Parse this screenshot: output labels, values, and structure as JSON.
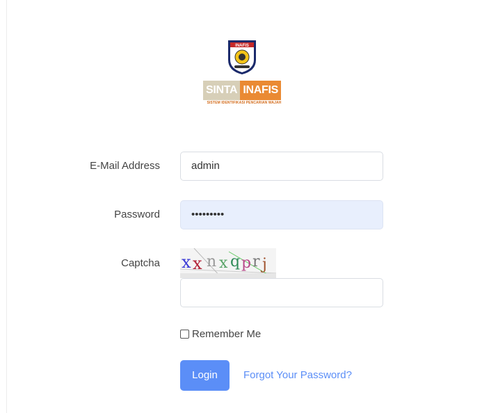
{
  "logo": {
    "emblem_text": "INAFIS",
    "brand_left": "SINTA",
    "brand_right": "INAFIS",
    "subtitle": "SISTEM IDENTIFIKASI PENCARIAN WAJAH",
    "colors": {
      "beige": "#d7cfb8",
      "orange": "#ea8a33",
      "red": "#c62828"
    }
  },
  "form": {
    "email": {
      "label": "E-Mail Address",
      "value": "admin"
    },
    "password": {
      "label": "Password",
      "masked_value": "•••••••••"
    },
    "captcha": {
      "label": "Captcha",
      "image_text": "xxnxqprj",
      "input_value": ""
    },
    "remember": {
      "label": "Remember Me",
      "checked": false
    },
    "login_label": "Login",
    "forgot_label": "Forgot Your Password?"
  },
  "colors": {
    "accent": "#5b8ef7",
    "autofill_bg": "#e8effd"
  }
}
